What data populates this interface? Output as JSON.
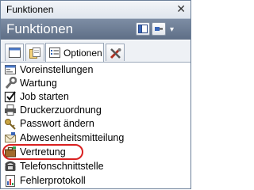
{
  "window": {
    "title": "Funktionen",
    "close_glyph": "✕"
  },
  "header": {
    "title": "Funktionen",
    "buttons": [
      {
        "icon": "layout-panel-icon"
      },
      {
        "icon": "pin-icon"
      }
    ],
    "dropdown_glyph": "▾"
  },
  "tabs": [
    {
      "icon": "window-icon",
      "label": ""
    },
    {
      "icon": "documents-icon",
      "label": ""
    },
    {
      "icon": "list-icon",
      "label": "Optionen",
      "active": true
    },
    {
      "icon": "tools-icon",
      "label": ""
    }
  ],
  "list": {
    "items": [
      {
        "label": "Voreinstellungen",
        "icon": "settings-window-icon"
      },
      {
        "label": "Wartung",
        "icon": "wrench-icon"
      },
      {
        "label": "Job starten",
        "icon": "checkbox-icon"
      },
      {
        "label": "Druckerzuordnung",
        "icon": "printer-icon"
      },
      {
        "label": "Passwort ändern",
        "icon": "key-icon"
      },
      {
        "label": "Abwesenheitsmitteilung",
        "icon": "mail-icon"
      },
      {
        "label": "Vertretung",
        "icon": "briefcase-icon",
        "highlighted": true
      },
      {
        "label": "Telefonschnittstelle",
        "icon": "phone-icon"
      },
      {
        "label": "Fehlerprotokoll",
        "icon": "report-icon"
      }
    ]
  },
  "colors": {
    "header_bg": "#6b7b93",
    "highlight_ring": "#d92020"
  }
}
